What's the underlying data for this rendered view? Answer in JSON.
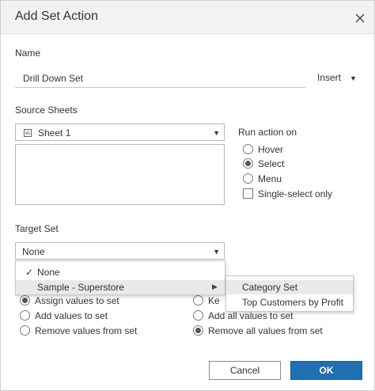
{
  "dialog": {
    "title": "Add Set Action",
    "close_icon": "close-icon"
  },
  "name_section": {
    "label": "Name",
    "value": "Drill Down Set",
    "insert_label": "Insert"
  },
  "source_sheets": {
    "label": "Source Sheets",
    "selected": "Sheet 1",
    "sheet_icon": "sheet-icon"
  },
  "run_action_on": {
    "label": "Run action on",
    "options": [
      {
        "label": "Hover",
        "checked": false
      },
      {
        "label": "Select",
        "checked": true
      },
      {
        "label": "Menu",
        "checked": false
      }
    ],
    "single_select_label": "Single-select only",
    "single_select_checked": false
  },
  "target_set": {
    "label": "Target Set",
    "selected": "None"
  },
  "dropdown_menu": {
    "items": [
      {
        "label": "None",
        "checked": true
      },
      {
        "label": "Sample - Superstore",
        "has_submenu": true
      }
    ],
    "submenu_items": [
      {
        "label": "Category Set"
      },
      {
        "label": "Top Customers by Profit"
      }
    ]
  },
  "running_action": {
    "options": [
      {
        "label": "Assign values to set",
        "checked": true
      },
      {
        "label": "Add values to set",
        "checked": false
      },
      {
        "label": "Remove values from set",
        "checked": false
      }
    ]
  },
  "clearing_selection": {
    "options": [
      {
        "label": "Keep set values",
        "visible_text": "Ke",
        "checked": false
      },
      {
        "label": "Add all values to set",
        "visible_text": "Add all values to set",
        "checked": false
      },
      {
        "label": "Remove all values from set",
        "checked": true
      }
    ]
  },
  "buttons": {
    "cancel": "Cancel",
    "ok": "OK"
  },
  "colors": {
    "title_bar": "#f2f2f2",
    "primary_button": "#1f6fb2",
    "menu_highlight": "#e9e9e9"
  }
}
